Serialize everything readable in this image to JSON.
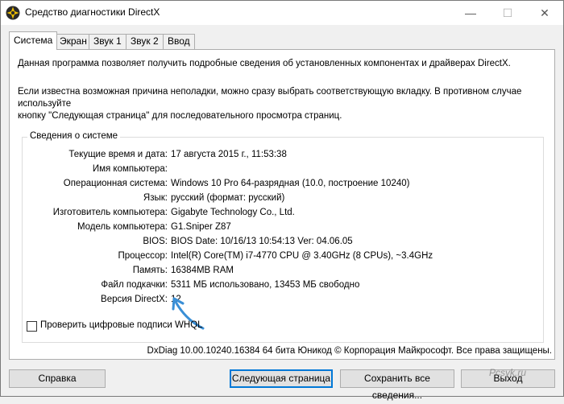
{
  "window": {
    "title": "Средство диагностики DirectX",
    "min_label": "—",
    "max_label": "☐",
    "close_label": "✕"
  },
  "tabs": [
    {
      "label": "Система",
      "active": true
    },
    {
      "label": "Экран"
    },
    {
      "label": "Звук 1"
    },
    {
      "label": "Звук 2"
    },
    {
      "label": "Ввод"
    }
  ],
  "intro": {
    "line1": "Данная программа позволяет получить подробные сведения об установленных компонентах и драйверах DirectX.",
    "line2": "Если известна возможная причина неполадки, можно сразу выбрать соответствующую вкладку. В противном случае используйте",
    "line3": "кнопку \"Следующая страница\" для последовательного просмотра страниц."
  },
  "system_info": {
    "group_title": "Сведения о системе",
    "rows": [
      {
        "label": "Текущие время и дата:",
        "value": "17 августа 2015 г., 11:53:38"
      },
      {
        "label": "Имя компьютера:",
        "value": ""
      },
      {
        "label": "Операционная система:",
        "value": "Windows 10 Pro 64-разрядная (10.0, построение 10240)"
      },
      {
        "label": "Язык:",
        "value": "русский (формат: русский)"
      },
      {
        "label": "Изготовитель компьютера:",
        "value": "Gigabyte Technology Co., Ltd."
      },
      {
        "label": "Модель компьютера:",
        "value": "G1.Sniper Z87"
      },
      {
        "label": "BIOS:",
        "value": "BIOS Date: 10/16/13 10:54:13 Ver: 04.06.05"
      },
      {
        "label": "Процессор:",
        "value": "Intel(R) Core(TM) i7-4770 CPU @ 3.40GHz (8 CPUs), ~3.4GHz"
      },
      {
        "label": "Память:",
        "value": "16384MB RAM"
      },
      {
        "label": "Файл подкачки:",
        "value": "5311 МБ использовано, 13453 МБ свободно"
      },
      {
        "label": "Версия DirectX:",
        "value": "12"
      }
    ]
  },
  "whql_checkbox": {
    "label": "Проверить цифровые подписи WHQL",
    "checked": false
  },
  "footer": "DxDiag 10.00.10240.16384 64 бита Юникод © Корпорация Майкрософт. Все права защищены.",
  "buttons": {
    "help": "Справка",
    "next": "Следующая страница",
    "save": "Сохранить все сведения...",
    "exit": "Выход"
  },
  "watermark": "Pcsyk.ru",
  "colors": {
    "accent": "#0078d7",
    "arrow": "#3a8fd6"
  }
}
